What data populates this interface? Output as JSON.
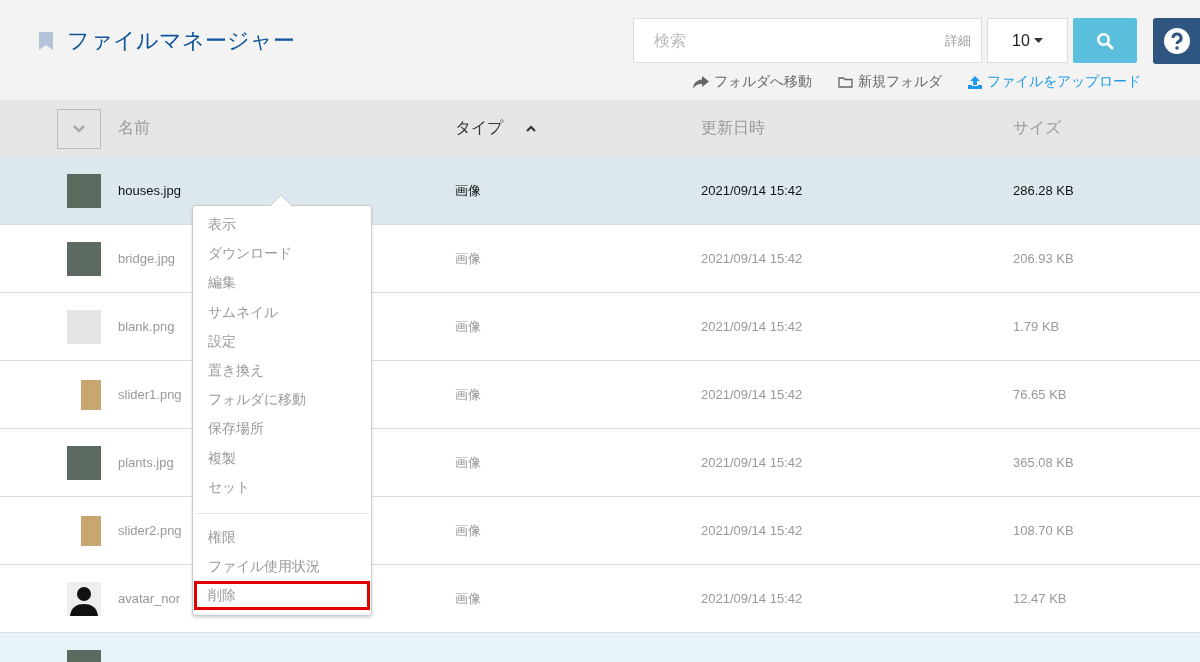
{
  "header": {
    "title": "ファイルマネージャー",
    "search": {
      "placeholder": "検索",
      "detail_label": "詳細"
    },
    "page_size": "10",
    "actions": [
      {
        "label": "フォルダへ移動",
        "kind": "move"
      },
      {
        "label": "新規フォルダ",
        "kind": "folder"
      },
      {
        "label": "ファイルをアップロード",
        "kind": "upload"
      }
    ]
  },
  "table": {
    "columns": [
      {
        "label": "名前",
        "sorted": false
      },
      {
        "label": "タイプ",
        "sorted": true
      },
      {
        "label": "更新日時",
        "sorted": false
      },
      {
        "label": "サイズ",
        "sorted": false
      }
    ],
    "rows": [
      {
        "name": "houses.jpg",
        "type": "画像",
        "modified": "2021/09/14 15:42",
        "size": "286.28 KB",
        "selected": true,
        "kind": "photo"
      },
      {
        "name": "bridge.jpg",
        "type": "画像",
        "modified": "2021/09/14 15:42",
        "size": "206.93 KB",
        "selected": false,
        "kind": "photo"
      },
      {
        "name": "blank.png",
        "type": "画像",
        "modified": "2021/09/14 15:42",
        "size": "1.79 KB",
        "selected": false,
        "kind": "blank"
      },
      {
        "name": "slider1.png",
        "type": "画像",
        "modified": "2021/09/14 15:42",
        "size": "76.65 KB",
        "selected": false,
        "kind": "small"
      },
      {
        "name": "plants.jpg",
        "type": "画像",
        "modified": "2021/09/14 15:42",
        "size": "365.08 KB",
        "selected": false,
        "kind": "photo"
      },
      {
        "name": "slider2.png",
        "type": "画像",
        "modified": "2021/09/14 15:42",
        "size": "108.70 KB",
        "selected": false,
        "kind": "small"
      },
      {
        "name": "avatar_nor",
        "type": "画像",
        "modified": "2021/09/14 15:42",
        "size": "12.47 KB",
        "selected": false,
        "kind": "avatar"
      }
    ]
  },
  "context_menu": {
    "groups": [
      [
        {
          "label": "表示",
          "highlighted": false
        },
        {
          "label": "ダウンロード",
          "highlighted": false
        },
        {
          "label": "編集",
          "highlighted": false
        },
        {
          "label": "サムネイル",
          "highlighted": false
        },
        {
          "label": "設定",
          "highlighted": false
        },
        {
          "label": "置き換え",
          "highlighted": false
        },
        {
          "label": "フォルダに移動",
          "highlighted": false
        },
        {
          "label": "保存場所",
          "highlighted": false
        },
        {
          "label": "複製",
          "highlighted": false
        },
        {
          "label": "セット",
          "highlighted": false
        }
      ],
      [
        {
          "label": "権限",
          "highlighted": false
        },
        {
          "label": "ファイル使用状況",
          "highlighted": false
        },
        {
          "label": "削除",
          "highlighted": true
        }
      ]
    ]
  }
}
